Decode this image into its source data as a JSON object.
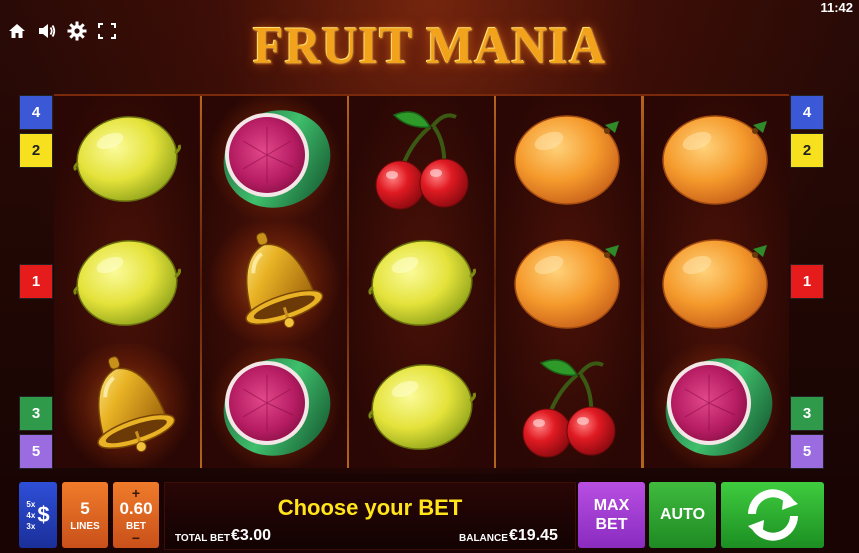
{
  "status_bar": {
    "clock": "11:42"
  },
  "header": {
    "logo_text": "FRUIT MANIA",
    "icons": [
      "home-icon",
      "sound-icon",
      "gear-icon",
      "fullscreen-icon"
    ]
  },
  "paylines": {
    "left": [
      {
        "label": "4",
        "color": "#3b59d6"
      },
      {
        "label": "2",
        "color": "#f7e11e"
      },
      {
        "label": "1",
        "color": "#e61c1c"
      },
      {
        "label": "3",
        "color": "#2f9b4a"
      },
      {
        "label": "5",
        "color": "#9b6be0"
      }
    ],
    "right": [
      {
        "label": "4",
        "color": "#3b59d6"
      },
      {
        "label": "2",
        "color": "#f7e11e"
      },
      {
        "label": "1",
        "color": "#e61c1c"
      },
      {
        "label": "3",
        "color": "#2f9b4a"
      },
      {
        "label": "5",
        "color": "#9b6be0"
      }
    ]
  },
  "reels": [
    [
      "lemon-icon",
      "lemon-icon",
      "bell-icon"
    ],
    [
      "watermelon-icon",
      "bell-icon",
      "watermelon-icon"
    ],
    [
      "cherries-icon",
      "lemon-icon",
      "lemon-icon"
    ],
    [
      "orange-icon",
      "orange-icon",
      "cherries-icon"
    ],
    [
      "orange-icon",
      "orange-icon",
      "watermelon-icon"
    ]
  ],
  "controls": {
    "paytable": {
      "lines": [
        "5x",
        "4x",
        "3x"
      ],
      "symbol": "$"
    },
    "lines": {
      "value": "5",
      "label": "LINES"
    },
    "bet": {
      "plus": "+",
      "value": "0.60",
      "label": "BET",
      "minus": "−"
    },
    "message": "Choose your BET",
    "total_bet_label": "TOTAL BET",
    "total_bet_value": "€3.00",
    "balance_label": "BALANCE",
    "balance_value": "€19.45",
    "max_bet_label_1": "MAX",
    "max_bet_label_2": "BET",
    "auto_label": "AUTO"
  },
  "colors": {
    "lemon": "#e9e64a",
    "orange": "#f59a2c",
    "melon_flesh": "#c0226b",
    "melon_rind": "#2f9f5c",
    "cherry": "#d81a20",
    "bell": "#e0a21a"
  }
}
